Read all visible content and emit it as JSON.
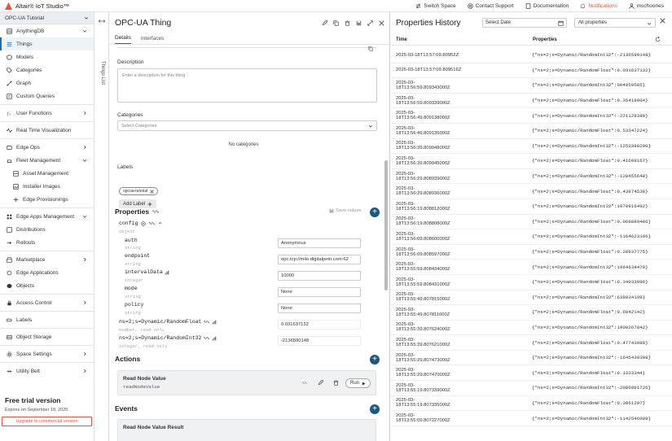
{
  "topbar": {
    "brand": "Altair® IoT Studio™",
    "items": [
      {
        "label": "Switch Space",
        "icon": "switch-icon"
      },
      {
        "label": "Contact Support",
        "icon": "support-icon"
      },
      {
        "label": "Documentation",
        "icon": "doc-icon"
      },
      {
        "label": "Notifications",
        "icon": "bell-icon"
      },
      {
        "label": "mschoones",
        "icon": "user-icon"
      }
    ]
  },
  "sidebar": {
    "space": "OPC-UA Tutorial",
    "items": [
      {
        "label": "AnythingDB",
        "icon": "db-icon",
        "chevron": true
      },
      {
        "label": "Things",
        "icon": "list-icon",
        "active": true
      },
      {
        "label": "Models",
        "icon": "cube-icon"
      },
      {
        "label": "Categories",
        "icon": "tag-icon"
      },
      {
        "label": "Graph",
        "icon": "graph-icon"
      },
      {
        "label": "Custom Queries",
        "icon": "query-icon"
      },
      {
        "label": "User Functions",
        "icon": "function-icon",
        "chevron": true
      },
      {
        "label": "Real Time Visualization",
        "icon": "pulse-icon"
      },
      {
        "label": "Edge Ops",
        "icon": "edge-icon",
        "chevron": true
      },
      {
        "label": "Fleet Management",
        "icon": "fleet-icon",
        "chevron": true
      },
      {
        "label": "Asset Management",
        "icon": "asset-icon",
        "sub": true
      },
      {
        "label": "Installer Images",
        "icon": "image-icon",
        "sub": true
      },
      {
        "label": "Edge Provisionings",
        "icon": "provision-icon",
        "sub": true
      },
      {
        "label": "Edge Apps Management",
        "icon": "apps-icon",
        "chevron": true
      },
      {
        "label": "Distributions",
        "icon": "distribution-icon"
      },
      {
        "label": "Rollouts",
        "icon": "rollout-icon"
      },
      {
        "label": "Marketplace",
        "icon": "market-icon",
        "chevron": true
      },
      {
        "label": "Edge Applications",
        "icon": "edgeapp-icon"
      },
      {
        "label": "Objects",
        "icon": "object-icon"
      },
      {
        "label": "Access Control",
        "icon": "lock-icon",
        "chevron": true
      },
      {
        "label": "Labels",
        "icon": "label-icon"
      },
      {
        "label": "Object Storage",
        "icon": "storage-icon"
      },
      {
        "label": "Space Settings",
        "icon": "gear-icon",
        "chevron": true
      },
      {
        "label": "Utility Belt",
        "icon": "belt-icon",
        "chevron": true
      }
    ],
    "trial_title": "Free trial version",
    "trial_expires": "Expires on September 18, 2025",
    "upgrade_label": "Upgrade to commercial version",
    "collapse_glyph": "«"
  },
  "things_list_label": "Things List",
  "thing": {
    "title": "OPC-UA Thing",
    "tabs": [
      "Details",
      "Interfaces"
    ],
    "description_label": "Description",
    "description_placeholder": "Enter a description for this thing",
    "categories_label": "Categories",
    "categories_placeholder": "Select Categories",
    "no_categories": "No categories",
    "labels_label": "Labels",
    "chip": "opcua-tutorial",
    "add_label": "Add Label",
    "properties_label": "Properties",
    "save_values": "Save values",
    "config": {
      "name": "config",
      "type": "object"
    },
    "props": [
      {
        "name": "auth",
        "type": "string",
        "value": "Anonymous"
      },
      {
        "name": "endpoint",
        "type": "string",
        "value": "opc.tcp://milo.digitalpetri.com:62"
      },
      {
        "name": "intervalData",
        "type": "integer",
        "value": "10000"
      },
      {
        "name": "mode",
        "type": "string",
        "value": "None"
      },
      {
        "name": "policy",
        "type": "string",
        "value": "None"
      }
    ],
    "ro_props": [
      {
        "name": "ns=2;s=Dynamic/RandomFloat",
        "type": "number, read only",
        "value": "0.031637132"
      },
      {
        "name": "ns=2;s=Dynamic/RandomInt32",
        "type": "integer, read only",
        "value": "-2136590148"
      }
    ],
    "actions_label": "Actions",
    "action": {
      "title": "Read Node Value",
      "sub": "readNodeValue",
      "run": "Run"
    },
    "events_label": "Events",
    "event": {
      "title": "Read Node Value Result"
    }
  },
  "history": {
    "title": "Properties History",
    "date_placeholder": "Select Date",
    "property_filter": "All properties",
    "col_time": "Time",
    "col_props": "Properties",
    "rows": [
      {
        "t": "2025-03-18T13:57:09.80952Z",
        "p": "{\"ns=2;s=Dynamic/RandomInt32\":-2136590148}"
      },
      {
        "t": "2025-03-18T13:57:09.809516Z",
        "p": "{\"ns=2;s=Dynamic/RandomFloat\":0.031637132}"
      },
      {
        "t": "2025-03-18T13:56:59.809343000Z",
        "p": "{\"ns=2;s=Dynamic/RandomInt32\":904959585}"
      },
      {
        "t": "2025-03-18T13:56:59.809339000Z",
        "p": "{\"ns=2;s=Dynamic/RandomFloat\":0.35418004}"
      },
      {
        "t": "2025-03-18T13:56:49.809138000Z",
        "p": "{\"ns=2;s=Dynamic/RandomInt32\":-221128380}"
      },
      {
        "t": "2025-03-18T13:56:49.809135000Z",
        "p": "{\"ns=2;s=Dynamic/RandomFloat\":0.53347224}"
      },
      {
        "t": "2025-03-18T13:56:39.809048000Z",
        "p": "{\"ns=2;s=Dynamic/RandomInt32\":-1253388290}"
      },
      {
        "t": "2025-03-18T13:56:39.809045000Z",
        "p": "{\"ns=2;s=Dynamic/RandomFloat\":0.41608167}"
      },
      {
        "t": "2025-03-18T13:56:29.808939000Z",
        "p": "{\"ns=2;s=Dynamic/RandomInt32\":-128455648}"
      },
      {
        "t": "2025-03-18T13:56:29.808936000Z",
        "p": "{\"ns=2;s=Dynamic/RandomFloat\":0.43874538}"
      },
      {
        "t": "2025-03-18T13:56:19.808812000Z",
        "p": "{\"ns=2;s=Dynamic/RandomInt32\":1070916492}"
      },
      {
        "t": "2025-03-18T13:56:19.808808000Z",
        "p": "{\"ns=2;s=Dynamic/RandomFloat\":0.069889486}"
      },
      {
        "t": "2025-03-18T13:56:09.808600000Z",
        "p": "{\"ns=2;s=Dynamic/RandomInt32\":-1164623106}"
      },
      {
        "t": "2025-03-18T13:56:09.808597000Z",
        "p": "{\"ns=2;s=Dynamic/RandomFloat\":0.28937775}"
      },
      {
        "t": "2025-03-18T13:55:59.808434000Z",
        "p": "{\"ns=2;s=Dynamic/RandomInt32\":1964634470}"
      },
      {
        "t": "2025-03-18T13:55:59.808431000Z",
        "p": "{\"ns=2;s=Dynamic/RandomFloat\":0.34933996}"
      },
      {
        "t": "2025-03-18T13:55:49.807815000Z",
        "p": "{\"ns=2;s=Dynamic/RandomInt32\":638934199}"
      },
      {
        "t": "2025-03-18T13:55:49.807811000Z",
        "p": "{\"ns=2;s=Dynamic/RandomFloat\":0.6042142}"
      },
      {
        "t": "2025-03-18T13:55:39.807624000Z",
        "p": "{\"ns=2;s=Dynamic/RandomInt32\":1900267842}"
      },
      {
        "t": "2025-03-18T13:55:39.807621000Z",
        "p": "{\"ns=2;s=Dynamic/RandomFloat\":0.47743988}"
      },
      {
        "t": "2025-03-18T13:55:29.807473000Z",
        "p": "{\"ns=2;s=Dynamic/RandomInt32\":-1645430398}"
      },
      {
        "t": "2025-03-18T13:55:29.807470000Z",
        "p": "{\"ns=2;s=Dynamic/RandomFloat\":0.1333344}"
      },
      {
        "t": "2025-03-18T13:55:19.807339000Z",
        "p": "{\"ns=2;s=Dynamic/RandomInt32\":-2086991726}"
      },
      {
        "t": "2025-03-18T13:55:19.807335000Z",
        "p": "{\"ns=2;s=Dynamic/RandomFloat\":0.3061297}"
      },
      {
        "t": "2025-03-18T13:55:09.807227000Z",
        "p": "{\"ns=2;s=Dynamic/RandomInt32\":-1142546009}"
      }
    ]
  },
  "colors": {
    "accent": "#1a6fb0",
    "notification": "#e8523b",
    "plus_button": "#1c5a7d",
    "sidebar_active": "#eef3f7"
  }
}
